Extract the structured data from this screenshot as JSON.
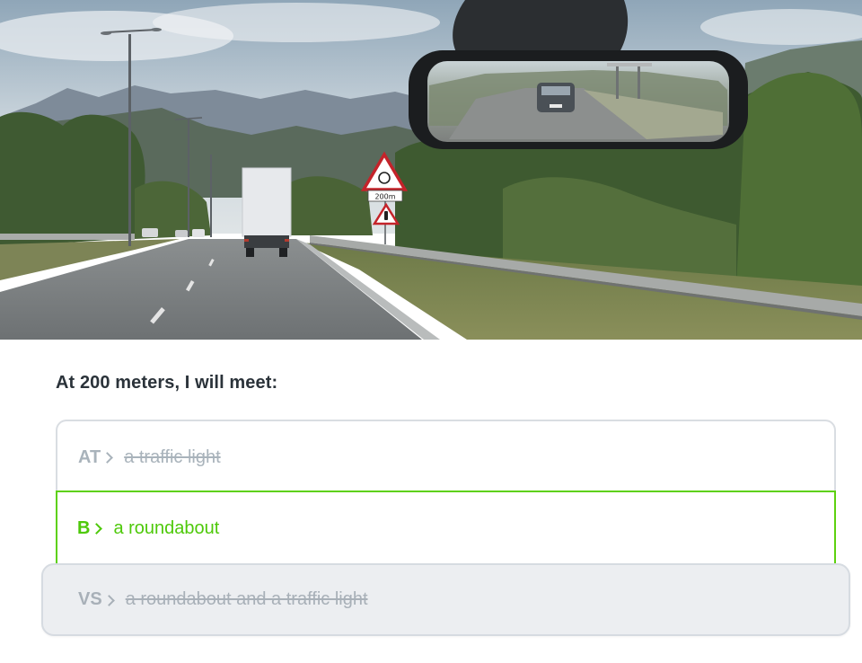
{
  "question": {
    "text": "At 200 meters, I will meet:"
  },
  "scene": {
    "sign_distance_label": "200m"
  },
  "answers": [
    {
      "key": "AT",
      "text": "a traffic light",
      "state": "struck-through"
    },
    {
      "key": "B",
      "text": "a roundabout",
      "state": "selected-correct"
    },
    {
      "key": "VS",
      "text": "a roundabout and a traffic light",
      "state": "struck-through"
    }
  ],
  "colors": {
    "correct": "#4ec90a",
    "struck": "#a9b3bb",
    "question_text": "#2b333a"
  }
}
